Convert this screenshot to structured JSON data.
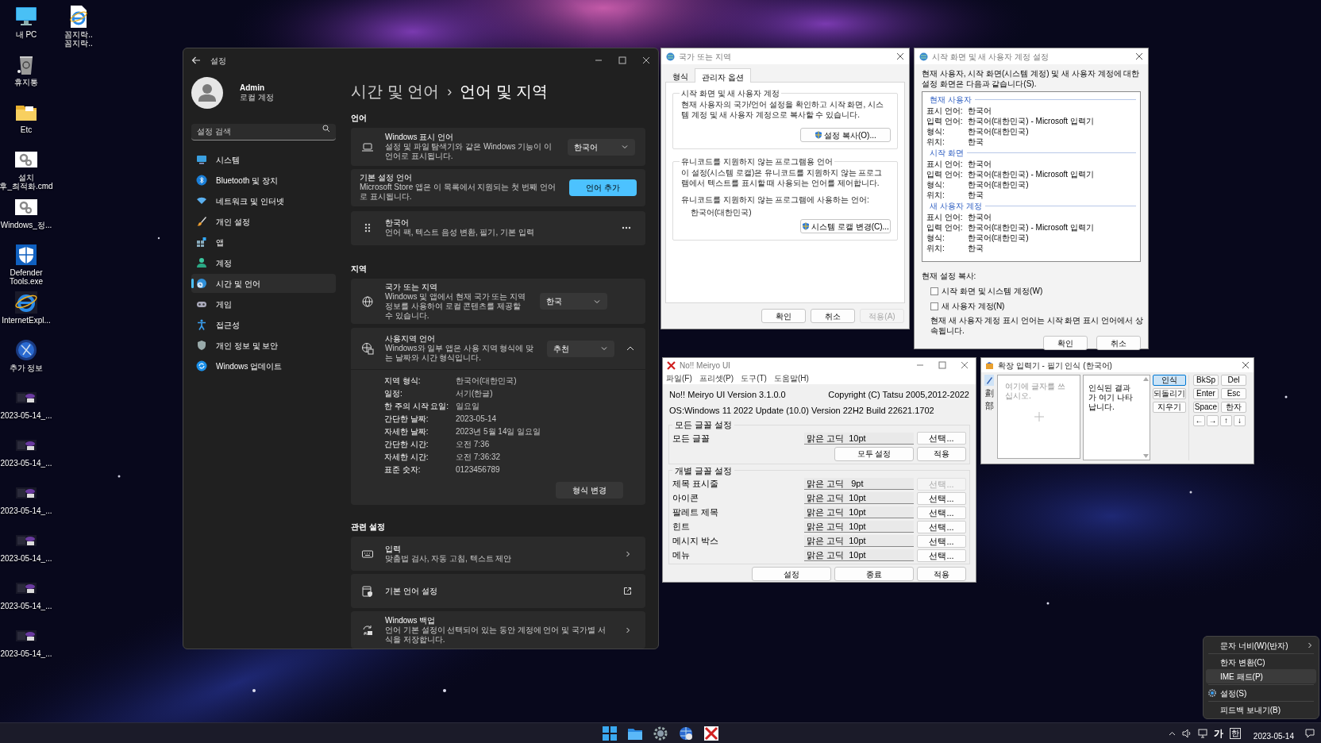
{
  "desktop": {
    "columns": [
      [
        {
          "kind": "monitor",
          "label": [
            "내 PC"
          ]
        },
        {
          "kind": "recycle_bin",
          "label": [
            "휴지통"
          ]
        },
        {
          "kind": "folder",
          "label": [
            "Etc"
          ]
        },
        {
          "kind": "gear_file",
          "label": [
            "설치",
            "후_최적화.cmd"
          ]
        },
        {
          "kind": "gear_file",
          "label": [
            "Windows_정..."
          ]
        },
        {
          "kind": "shield",
          "label": [
            "Defender",
            "Tools.exe"
          ]
        },
        {
          "kind": "browser",
          "label": [
            "InternetExpl..."
          ]
        },
        {
          "kind": "globe",
          "label": [
            "추가 정보"
          ]
        },
        {
          "kind": "screenshot",
          "label": [
            "2023-05-14_..."
          ]
        },
        {
          "kind": "screenshot",
          "label": [
            "2023-05-14_..."
          ]
        },
        {
          "kind": "screenshot",
          "label": [
            "2023-05-14_..."
          ]
        },
        {
          "kind": "screenshot",
          "label": [
            "2023-05-14_..."
          ]
        },
        {
          "kind": "screenshot",
          "label": [
            "2023-05-14_..."
          ]
        },
        {
          "kind": "screenshot",
          "label": [
            "2023-05-14_..."
          ]
        }
      ],
      [
        {
          "kind": "browser_file",
          "label": [
            "꼼지락..",
            "꼼지락.."
          ]
        }
      ]
    ]
  },
  "settings": {
    "title": "설정",
    "user": {
      "name": "Admin",
      "subtitle": "로컬 계정"
    },
    "search": {
      "placeholder": "설정 검색"
    },
    "nav": [
      {
        "kind": "system",
        "label": "시스템",
        "selected": false
      },
      {
        "kind": "bluetooth",
        "label": "Bluetooth 및 장치",
        "selected": false
      },
      {
        "kind": "network",
        "label": "네트워크 및 인터넷",
        "selected": false
      },
      {
        "kind": "personalization",
        "label": "개인 설정",
        "selected": false
      },
      {
        "kind": "apps",
        "label": "앱",
        "selected": false
      },
      {
        "kind": "accounts",
        "label": "계정",
        "selected": false
      },
      {
        "kind": "time_language",
        "label": "시간 및 언어",
        "selected": true
      },
      {
        "kind": "gaming",
        "label": "게임",
        "selected": false
      },
      {
        "kind": "accessibility",
        "label": "접근성",
        "selected": false
      },
      {
        "kind": "privacy",
        "label": "개인 정보 및 보안",
        "selected": false
      },
      {
        "kind": "update",
        "label": "Windows 업데이트",
        "selected": false
      }
    ],
    "breadcrumb": [
      "시간 및 언어",
      "언어 및 지역"
    ],
    "breadcrumb_separator": "›",
    "language": {
      "heading": "언어",
      "display_language": {
        "title": "Windows 표시 언어",
        "description": "설정 및 파일 탐색기와 같은 Windows 기능이 이 언어로 표시됩니다.",
        "value": "한국어"
      },
      "preferred": {
        "title": "기본 설정 언어",
        "description": "Microsoft Store 앱은 이 목록에서 지원되는 첫 번째 언어로 표시됩니다.",
        "button": "언어 추가"
      },
      "installed": {
        "title": "한국어",
        "description": "언어 팩, 텍스트 음성 변환, 필기, 기본 입력"
      }
    },
    "region": {
      "heading": "지역",
      "country": {
        "title": "국가 또는 지역",
        "description": "Windows 및 앱에서 현재 국가 또는 지역 정보를 사용하여 로컬 콘텐츠를 제공할 수 있습니다.",
        "value": "한국"
      },
      "format": {
        "title": "사용지역 언어",
        "description": "Windows와 일부 앱은 사용 지역 형식에 맞는 날짜와 시간 형식입니다.",
        "value": "추천",
        "expanded": true,
        "details": [
          {
            "label": "지역 형식:",
            "value": "한국어(대한민국)"
          },
          {
            "label": "일정:",
            "value": "서기(한글)"
          },
          {
            "label": "한 주의 시작 요일:",
            "value": "일요일"
          },
          {
            "label": "간단한 날짜:",
            "value": "2023-05-14"
          },
          {
            "label": "자세한 날짜:",
            "value": "2023년 5월 14일 일요일"
          },
          {
            "label": "간단한 시간:",
            "value": "오전 7:36"
          },
          {
            "label": "자세한 시간:",
            "value": "오전 7:36:32"
          },
          {
            "label": "표준 숫자:",
            "value": "0123456789"
          }
        ],
        "button": "형식 변경"
      }
    },
    "related": {
      "heading": "관련 설정",
      "items": [
        {
          "kind": "input",
          "title": "입력",
          "description": "맞춤법 검사, 자동 고침, 텍스트 제안"
        },
        {
          "kind": "language_settings",
          "title": "기본 언어 설정"
        },
        {
          "kind": "backup",
          "title": "Windows 백업",
          "description": "언어 기본 설정이 선택되어 있는 동안 계정에 언어 및 국가별 서식을 저장합니다."
        }
      ]
    }
  },
  "region_dialog": {
    "title": "국가 또는 지역",
    "tabs": [
      {
        "label": "형식",
        "selected": false
      },
      {
        "label": "관리자 옵션",
        "selected": true
      }
    ],
    "welcome": {
      "title": "시작 화면 및 새 사용자 계정",
      "text": "현재 사용자의 국가/언어 설정을 확인하고 시작 화면, 시스템 계정 및 새 사용자 계정으로 복사할 수 있습니다.",
      "button": "설정 복사(O)..."
    },
    "unicode": {
      "title": "유니코드를 지원하지 않는 프로그램용 언어",
      "text": "이 설정(시스템 로캘)은 유니코드를 지원하지 않는 프로그램에서 텍스트를 표시할 때 사용되는 언어를 제어합니다.",
      "label": "유니코드를 지원하지 않는 프로그램에 사용하는 언어:",
      "value": "한국어(대한민국)",
      "button": "시스템 로캘 변경(C)..."
    },
    "buttons": [
      {
        "label": "확인",
        "disabled": false
      },
      {
        "label": "취소",
        "disabled": false
      },
      {
        "label": "적용(A)",
        "disabled": true
      }
    ]
  },
  "copy_dialog": {
    "title": "시작 화면 및 새 사용자 계정 설정",
    "intro": "현재 사용자, 시작 화면(시스템 계정) 및 새 사용자 계정에 대한 설정 화면은 다음과 같습니다(S).",
    "groups": [
      {
        "title": "현재 사용자",
        "rows": [
          {
            "label": "표시 언어:",
            "value": "한국어"
          },
          {
            "label": "입력 언어:",
            "value": "한국어(대한민국) - Microsoft 입력기"
          },
          {
            "label": "형식:",
            "value": "한국어(대한민국)"
          },
          {
            "label": "위치:",
            "value": "한국"
          }
        ]
      },
      {
        "title": "시작 화면",
        "rows": [
          {
            "label": "표시 언어:",
            "value": "한국어"
          },
          {
            "label": "입력 언어:",
            "value": "한국어(대한민국) - Microsoft 입력기"
          },
          {
            "label": "형식:",
            "value": "한국어(대한민국)"
          },
          {
            "label": "위치:",
            "value": "한국"
          }
        ]
      },
      {
        "title": "새 사용자 계정",
        "rows": [
          {
            "label": "표시 언어:",
            "value": "한국어"
          },
          {
            "label": "입력 언어:",
            "value": "한국어(대한민국) - Microsoft 입력기"
          },
          {
            "label": "형식:",
            "value": "한국어(대한민국)"
          },
          {
            "label": "위치:",
            "value": "한국"
          }
        ]
      }
    ],
    "copy_label": "현재 설정 복사:",
    "options": [
      {
        "label": "시작 화면 및 시스템 계정(W)",
        "checked": false
      },
      {
        "label": "새 사용자 계정(N)",
        "checked": false
      }
    ],
    "note": "현재 새 사용자 계정 표시 언어는 시작 화면 표시 언어에서 상속됩니다.",
    "buttons": [
      "확인",
      "취소"
    ]
  },
  "meiryo": {
    "title": "No!! Meiryo UI",
    "menu": [
      "파일(F)",
      "프리셋(P)",
      "도구(T)",
      "도움말(H)"
    ],
    "version": "No!! Meiryo UI Version 3.1.0.0",
    "copyright": "Copyright (C) Tatsu 2005,2012-2022",
    "os": "OS:Windows 11 2022 Update (10.0) Version 22H2 Build 22621.1702",
    "all_fonts": {
      "title": "모든 글꼴 설정",
      "rows": [
        {
          "label": "모든 글꼴",
          "font": "맑은 고딕  10pt",
          "button": "선택...",
          "disabled": false
        }
      ],
      "buttons": [
        "모두 설정",
        "적용"
      ]
    },
    "individual": {
      "title": "개별 글꼴 설정",
      "rows": [
        {
          "label": "제목 표시줄",
          "font": "맑은 고딕   9pt",
          "button": "선택...",
          "disabled": true
        },
        {
          "label": "아이콘",
          "font": "맑은 고딕  10pt",
          "button": "선택...",
          "disabled": false
        },
        {
          "label": "팔레트 제목",
          "font": "맑은 고딕  10pt",
          "button": "선택...",
          "disabled": false
        },
        {
          "label": "힌트",
          "font": "맑은 고딕  10pt",
          "button": "선택...",
          "disabled": false
        },
        {
          "label": "메시지 박스",
          "font": "맑은 고딕  10pt",
          "button": "선택...",
          "disabled": false
        },
        {
          "label": "메뉴",
          "font": "맑은 고딕  10pt",
          "button": "선택...",
          "disabled": false
        }
      ]
    },
    "buttons": [
      "설정",
      "종료",
      "적용"
    ]
  },
  "ime_pad": {
    "title": "확장 입력기 - 필기 인식 (한국어)",
    "tools": [
      "劃",
      "部"
    ],
    "placeholder": "여기에 글자를 쓰십시오.",
    "result": "인식된 결과가 여기 나타납니다.",
    "actions": [
      {
        "label": "인식",
        "selected": true
      },
      {
        "label": "되돌리기",
        "selected": false
      },
      {
        "label": "지우기",
        "selected": false
      }
    ],
    "keys": [
      "BkSp",
      "Del",
      "Enter",
      "Esc",
      "Space",
      "한자"
    ],
    "arrows": [
      "←",
      "→",
      "↑",
      "↓"
    ]
  },
  "context_menu": {
    "items": [
      {
        "kind": "submenu",
        "label": "문자 너비(W)(반자)",
        "selected": false
      },
      {
        "kind": "separator"
      },
      {
        "kind": "command",
        "label": "한자 변환(C)",
        "selected": false
      },
      {
        "kind": "command",
        "label": "IME 패드(P)",
        "selected": true
      },
      {
        "kind": "separator"
      },
      {
        "kind": "gear",
        "label": "설정(S)",
        "selected": false
      },
      {
        "kind": "separator"
      },
      {
        "kind": "command",
        "label": "피드백 보내기(B)",
        "selected": false
      }
    ]
  },
  "taskbar": {
    "apps": [
      {
        "kind": "start"
      },
      {
        "kind": "explorer"
      },
      {
        "kind": "settings"
      },
      {
        "kind": "globe"
      },
      {
        "kind": "meiryo"
      }
    ],
    "ime_mode": "가",
    "hangul_mode": "한",
    "date": "2023-05-14"
  }
}
